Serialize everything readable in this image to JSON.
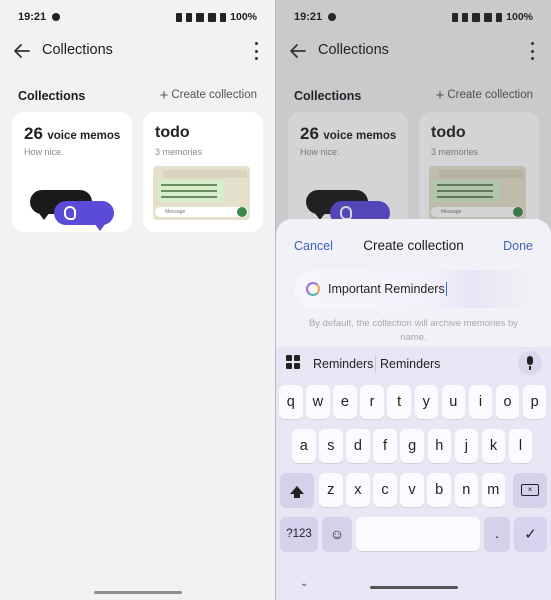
{
  "status": {
    "time": "19:21",
    "battery": "100%"
  },
  "appbar": {
    "title": "Collections"
  },
  "section": {
    "title": "Collections",
    "create_label": "Create collection"
  },
  "cards": [
    {
      "count": "26",
      "title_rest": "voice memos",
      "subtitle": "How nice."
    },
    {
      "title": "todo",
      "subtitle": "3 memories",
      "preview_input": "Message"
    }
  ],
  "sheet": {
    "cancel": "Cancel",
    "title": "Create collection",
    "done": "Done",
    "field_value": "Important Reminders",
    "hint": "By default, the collection will archive memories by name."
  },
  "keyboard": {
    "suggestions": [
      "Reminders",
      "Reminders"
    ],
    "row1": [
      "q",
      "w",
      "e",
      "r",
      "t",
      "y",
      "u",
      "i",
      "o",
      "p"
    ],
    "row2": [
      "a",
      "s",
      "d",
      "f",
      "g",
      "h",
      "j",
      "k",
      "l"
    ],
    "row3": [
      "z",
      "x",
      "c",
      "v",
      "b",
      "n",
      "m"
    ],
    "symbols_label": "?123",
    "emoji_label": "☺",
    "period_label": ".",
    "enter_label": "✓"
  }
}
